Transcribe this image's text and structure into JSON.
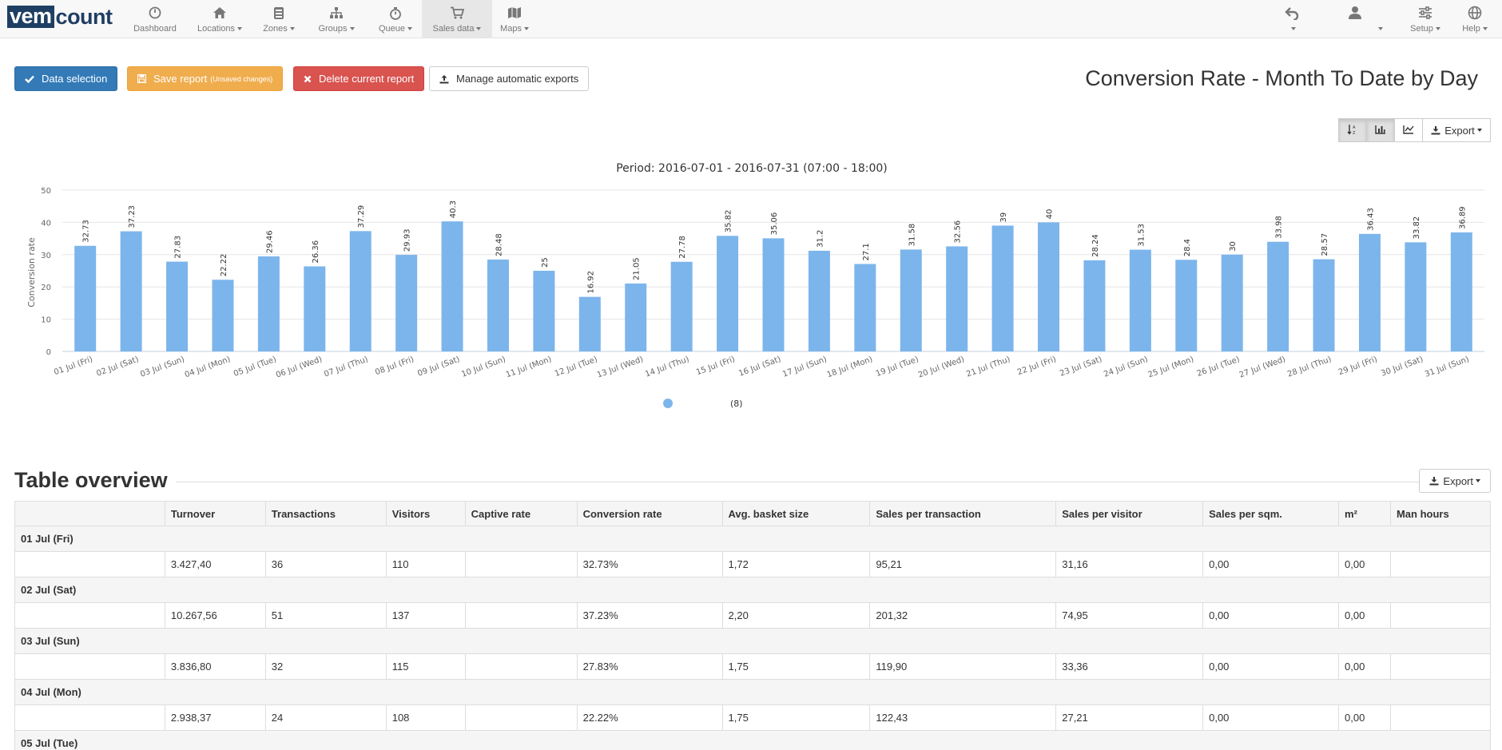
{
  "nav": {
    "logo_a": "vem",
    "logo_b": "count",
    "items": [
      {
        "label": "Dashboard",
        "caret": false
      },
      {
        "label": "Locations",
        "caret": true
      },
      {
        "label": "Zones",
        "caret": true
      },
      {
        "label": "Groups",
        "caret": true
      },
      {
        "label": "Queue",
        "caret": true
      },
      {
        "label": "Sales data",
        "caret": true
      },
      {
        "label": "Maps",
        "caret": true
      }
    ],
    "active": "Sales data",
    "right": {
      "setup": "Setup",
      "help": "Help"
    }
  },
  "toolbar": {
    "data_selection": "Data selection",
    "save_report": "Save report",
    "save_note": "(Unsaved changes)",
    "delete_report": "Delete current report",
    "manage_exports": "Manage automatic exports"
  },
  "page_title": "Conversion Rate - Month To Date by Day",
  "chart_tools": {
    "export": "Export"
  },
  "chart_data": {
    "type": "bar",
    "title": "Period: 2016-07-01 - 2016-07-31 (07:00 - 18:00)",
    "ylabel": "Conversion rate",
    "xlabel": "",
    "ylim": [
      0,
      50
    ],
    "yticks": [
      0,
      10,
      20,
      30,
      40,
      50
    ],
    "grid": true,
    "legend_position": "bottom-center",
    "legend_suffix": "(8)",
    "bar_color": "#7cb5ec",
    "categories": [
      "01 Jul (Fri)",
      "02 Jul (Sat)",
      "03 Jul (Sun)",
      "04 Jul (Mon)",
      "05 Jul (Tue)",
      "06 Jul (Wed)",
      "07 Jul (Thu)",
      "08 Jul (Fri)",
      "09 Jul (Sat)",
      "10 Jul (Sun)",
      "11 Jul (Mon)",
      "12 Jul (Tue)",
      "13 Jul (Wed)",
      "14 Jul (Thu)",
      "15 Jul (Fri)",
      "16 Jul (Sat)",
      "17 Jul (Sun)",
      "18 Jul (Mon)",
      "19 Jul (Tue)",
      "20 Jul (Wed)",
      "21 Jul (Thu)",
      "22 Jul (Fri)",
      "23 Jul (Sat)",
      "24 Jul (Sun)",
      "25 Jul (Mon)",
      "26 Jul (Tue)",
      "27 Jul (Wed)",
      "28 Jul (Thu)",
      "29 Jul (Fri)",
      "30 Jul (Sat)",
      "31 Jul (Sun)"
    ],
    "values": [
      32.73,
      37.23,
      27.83,
      22.22,
      29.46,
      26.36,
      37.29,
      29.93,
      40.3,
      28.48,
      25,
      16.92,
      21.05,
      27.78,
      35.82,
      35.06,
      31.2,
      27.1,
      31.58,
      32.56,
      39,
      40,
      28.24,
      31.53,
      28.4,
      30,
      33.98,
      28.57,
      36.43,
      33.82,
      36.89
    ],
    "labels": [
      "32.73",
      "37.23",
      "27.83",
      "22.22",
      "29.46",
      "26.36",
      "37.29",
      "29.93",
      "40.3",
      "28.48",
      "25",
      "16.92",
      "21.05",
      "27.78",
      "35.82",
      "35.06",
      "31.2",
      "27.1",
      "31.58",
      "32.56",
      "39",
      "40",
      "28.24",
      "31.53",
      "28.4",
      "30",
      "33.98",
      "28.57",
      "36.43",
      "33.82",
      "36.89"
    ]
  },
  "table": {
    "title": "Table overview",
    "export": "Export",
    "columns": [
      "",
      "Turnover",
      "Transactions",
      "Visitors",
      "Captive rate",
      "Conversion rate",
      "Avg. basket size",
      "Sales per transaction",
      "Sales per visitor",
      "Sales per sqm.",
      "m²",
      "Man hours"
    ],
    "groups": [
      {
        "label": "01 Jul (Fri)",
        "row": [
          "",
          "3.427,40",
          "36",
          "110",
          "",
          "32.73%",
          "1,72",
          "95,21",
          "31,16",
          "0,00",
          "0,00",
          ""
        ]
      },
      {
        "label": "02 Jul (Sat)",
        "row": [
          "",
          "10.267,56",
          "51",
          "137",
          "",
          "37.23%",
          "2,20",
          "201,32",
          "74,95",
          "0,00",
          "0,00",
          ""
        ]
      },
      {
        "label": "03 Jul (Sun)",
        "row": [
          "",
          "3.836,80",
          "32",
          "115",
          "",
          "27.83%",
          "1,75",
          "119,90",
          "33,36",
          "0,00",
          "0,00",
          ""
        ]
      },
      {
        "label": "04 Jul (Mon)",
        "row": [
          "",
          "2.938,37",
          "24",
          "108",
          "",
          "22.22%",
          "1,75",
          "122,43",
          "27,21",
          "0,00",
          "0,00",
          ""
        ]
      },
      {
        "label": "05 Jul (Tue)",
        "row": null
      }
    ]
  }
}
